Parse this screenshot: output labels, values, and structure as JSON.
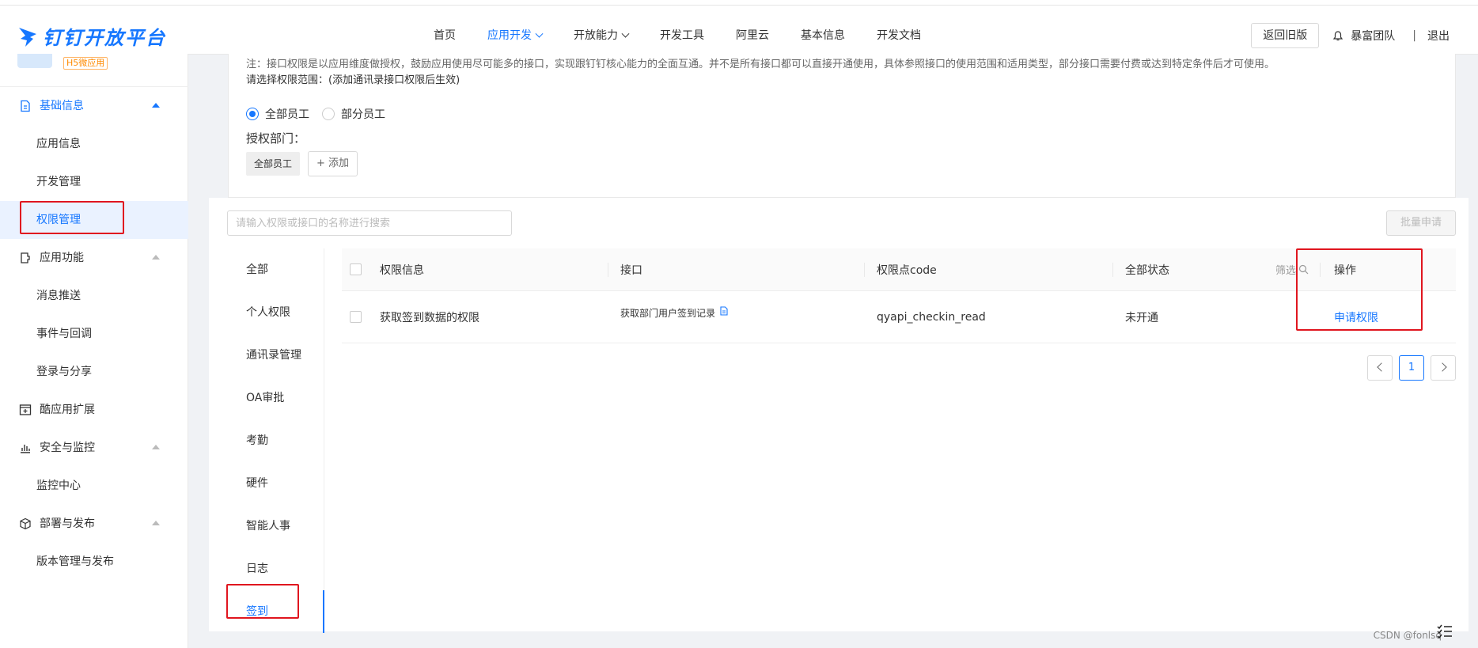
{
  "brand": {
    "name": "钉钉开放平台",
    "color": "#1677ff"
  },
  "nav": {
    "items": [
      {
        "label": "首页",
        "active": false,
        "dropdown": false
      },
      {
        "label": "应用开发",
        "active": true,
        "dropdown": true
      },
      {
        "label": "开放能力",
        "active": false,
        "dropdown": true
      },
      {
        "label": "开发工具",
        "active": false,
        "dropdown": false
      },
      {
        "label": "阿里云",
        "active": false,
        "dropdown": false
      },
      {
        "label": "基本信息",
        "active": false,
        "dropdown": false
      },
      {
        "label": "开发文档",
        "active": false,
        "dropdown": false
      }
    ],
    "back_old": "返回旧版",
    "team": "暴富团队",
    "separator": "|",
    "logout": "退出"
  },
  "sidebar": {
    "app_badge": "H5微应用",
    "groups": [
      {
        "label": "基础信息",
        "icon": "document-icon",
        "open": true
      },
      {
        "label": "应用功能",
        "icon": "plugin-icon",
        "open": false
      },
      {
        "label": "酷应用扩展",
        "icon": "add-box-icon",
        "open": false
      },
      {
        "label": "安全与监控",
        "icon": "bar-chart-icon",
        "open": false
      },
      {
        "label": "部署与发布",
        "icon": "cube-icon",
        "open": false
      }
    ],
    "items": {
      "app_info": "应用信息",
      "dev_manage": "开发管理",
      "permission_manage": "权限管理",
      "message_push": "消息推送",
      "event_callback": "事件与回调",
      "login_share": "登录与分享",
      "monitor_center": "监控中心",
      "version_release": "版本管理与发布"
    }
  },
  "permission_scope": {
    "note": "注：接口权限是以应用维度做授权，鼓励应用使用尽可能多的接口，实现跟钉钉核心能力的全面互通。并不是所有接口都可以直接开通使用，具体参照接口的使用范围和适用类型，部分接口需要付费或达到特定条件后才可使用。",
    "scope_label": "请选择权限范围：(添加通讯录接口权限后生效)",
    "radio_all": "全部员工",
    "radio_part": "部分员工",
    "selected": "全部员工",
    "auth_dept_label": "授权部门：",
    "dept_tag": "全部员工",
    "add_button": "添加"
  },
  "search": {
    "placeholder": "请输入权限或接口的名称进行搜索"
  },
  "batch_apply": "批量申请",
  "categories": [
    "全部",
    "个人权限",
    "通讯录管理",
    "OA审批",
    "考勤",
    "硬件",
    "智能人事",
    "日志",
    "签到"
  ],
  "active_category": "签到",
  "table": {
    "headers": {
      "perm_info": "权限信息",
      "api": "接口",
      "code": "权限点code",
      "status": "全部状态",
      "filter": "筛选",
      "action": "操作"
    },
    "rows": [
      {
        "perm_info": "获取签到数据的权限",
        "api": "获取部门用户签到记录",
        "code": "qyapi_checkin_read",
        "status": "未开通",
        "action": "申请权限"
      }
    ]
  },
  "pagination": {
    "current": "1"
  },
  "watermark": "CSDN @fonlsq"
}
